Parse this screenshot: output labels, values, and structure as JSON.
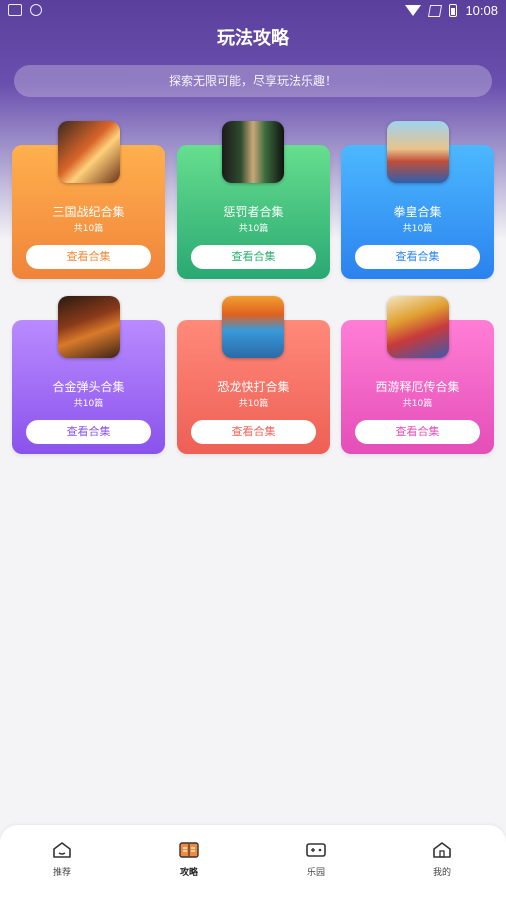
{
  "status_bar": {
    "time": "10:08"
  },
  "header": {
    "title": "玩法攻略",
    "search_placeholder": "探索无限可能，尽享玩法乐趣！"
  },
  "cards": [
    {
      "name": "三国战纪合集",
      "count": "共10篇",
      "button": "查看合集",
      "accent": "#f08a3c",
      "thumb_icon": "sanguo-zhanji-icon"
    },
    {
      "name": "惩罚者合集",
      "count": "共10篇",
      "button": "查看合集",
      "accent": "#2fae73",
      "thumb_icon": "punisher-icon"
    },
    {
      "name": "拳皇合集",
      "count": "共10篇",
      "button": "查看合集",
      "accent": "#2f86f0",
      "thumb_icon": "kof-icon"
    },
    {
      "name": "合金弹头合集",
      "count": "共10篇",
      "button": "查看合集",
      "accent": "#8a55ec",
      "thumb_icon": "metal-slug-icon"
    },
    {
      "name": "恐龙快打合集",
      "count": "共10篇",
      "button": "查看合集",
      "accent": "#ee6458",
      "thumb_icon": "cadillacs-dinosaurs-icon"
    },
    {
      "name": "西游释厄传合集",
      "count": "共10篇",
      "button": "查看合集",
      "accent": "#e451b8",
      "thumb_icon": "journey-west-icon"
    }
  ],
  "tabbar": {
    "items": [
      {
        "label": "推荐",
        "icon": "home-icon"
      },
      {
        "label": "攻略",
        "icon": "book-icon",
        "active": true
      },
      {
        "label": "乐园",
        "icon": "gamepad-icon"
      },
      {
        "label": "我的",
        "icon": "profile-home-icon"
      }
    ]
  }
}
